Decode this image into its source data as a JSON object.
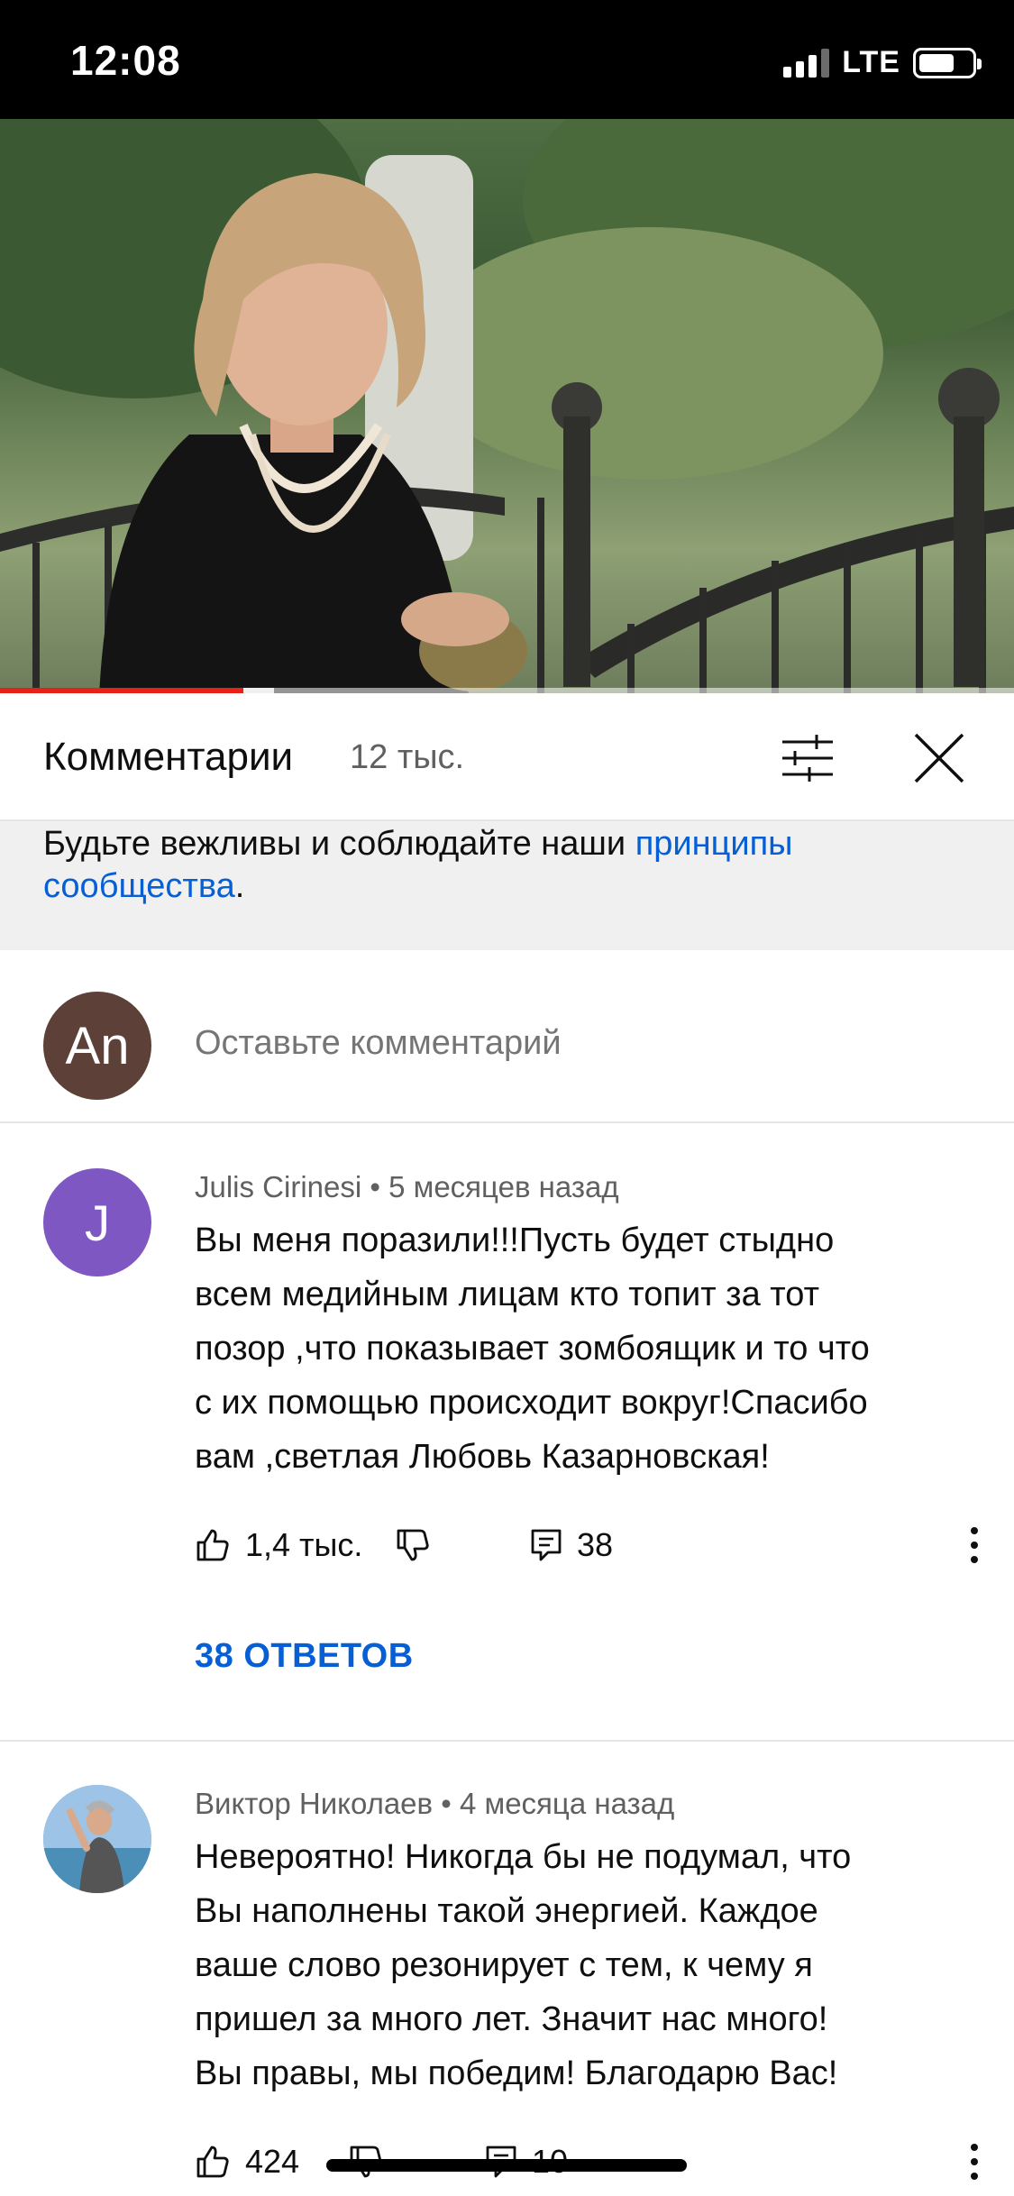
{
  "status_bar": {
    "time": "12:08",
    "network": "LTE"
  },
  "video": {
    "progress_fraction": 0.24,
    "buffered_fraction": 0.27
  },
  "comments_header": {
    "title": "Комментарии",
    "count": "12 тыс.",
    "filter_icon": "sliders-icon",
    "close_icon": "close-icon"
  },
  "guidelines": {
    "text": "Будьте вежливы и соблюдайте наши ",
    "link": "принципы сообщества",
    "suffix": "."
  },
  "add_comment": {
    "avatar_initials": "An",
    "avatar_color": "#5d4037",
    "placeholder": "Оставьте комментарий"
  },
  "comments": [
    {
      "avatar_letter": "J",
      "avatar_color": "#7e57c2",
      "author": "Julis Cirinesi",
      "time": "5 месяцев назад",
      "text_lines": [
        "Вы меня поразили!!!Пусть будет стыдно",
        "всем медийным лицам кто топит за тот",
        "позор ,что показывает зомбоящик и то что",
        "с их помощью происходит вокруг!Спасибо",
        "вам ,светлая Любовь Казарновская!"
      ],
      "likes": "1,4 тыс.",
      "replies_count": "38",
      "replies_link": "38 ОТВЕТОВ"
    },
    {
      "avatar_letter": "",
      "author": "Виктор Николаев",
      "time": "4 месяца назад",
      "text_lines": [
        "Невероятно! Никогда бы не подумал, что",
        "Вы наполнены такой энергией. Каждое",
        "ваше слово резонирует с тем, к чему я",
        "пришел за много лет. Значит нас много!",
        "Вы правы, мы победим! Благодарю Вас!"
      ],
      "likes": "424",
      "replies_count": "10"
    }
  ]
}
